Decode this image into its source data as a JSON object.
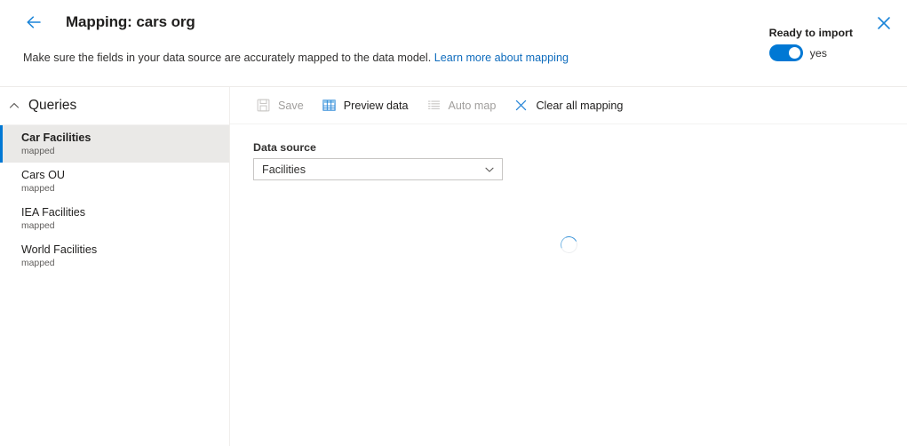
{
  "header": {
    "back_icon": "arrow-left-icon",
    "title": "Mapping: cars org",
    "subtitle_text": "Make sure the fields in your data source are accurately mapped to the data model.",
    "subtitle_link": "Learn more about mapping",
    "ready_label": "Ready to import",
    "toggle_state_text": "yes",
    "toggle_on": true,
    "close_icon": "close-icon",
    "accent_color": "#0078d4",
    "link_color": "#0f6cbd"
  },
  "sidebar": {
    "section_title": "Queries",
    "collapse_icon": "chevron-up-icon",
    "items": [
      {
        "name": "Car Facilities",
        "status": "mapped",
        "selected": true
      },
      {
        "name": "Cars OU",
        "status": "mapped",
        "selected": false
      },
      {
        "name": "IEA Facilities",
        "status": "mapped",
        "selected": false
      },
      {
        "name": "World Facilities",
        "status": "mapped",
        "selected": false
      }
    ],
    "selected_bg": "#eae9e7",
    "selected_accent": "#0078d4"
  },
  "toolbar": {
    "buttons": [
      {
        "label": "Save",
        "icon": "save-icon",
        "enabled": false
      },
      {
        "label": "Preview data",
        "icon": "table-grid-icon",
        "enabled": true
      },
      {
        "label": "Auto map",
        "icon": "list-icon",
        "enabled": false
      },
      {
        "label": "Clear all mapping",
        "icon": "close-x-icon",
        "enabled": true
      }
    ]
  },
  "main": {
    "data_source_label": "Data source",
    "data_source_value": "Facilities",
    "dropdown_icon": "chevron-down-icon",
    "loading_icon": "spinner-icon"
  }
}
